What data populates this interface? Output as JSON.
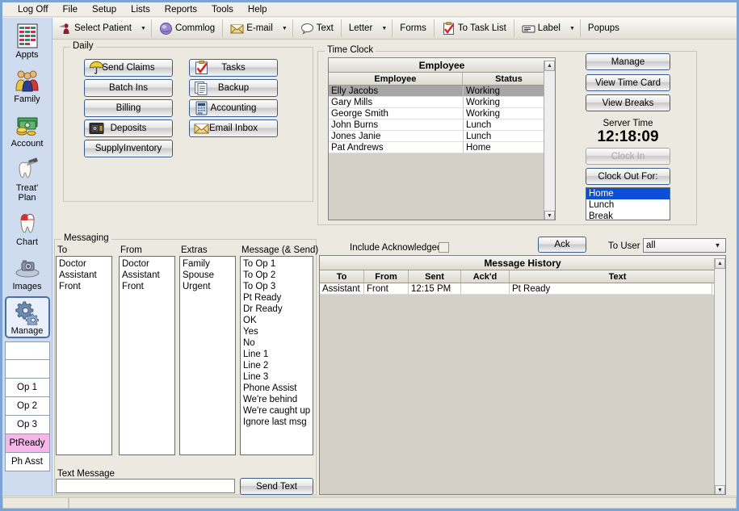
{
  "menu": {
    "items": [
      "Log Off",
      "File",
      "Setup",
      "Lists",
      "Reports",
      "Tools",
      "Help"
    ]
  },
  "toolbar": {
    "select_patient": "Select Patient",
    "commlog": "Commlog",
    "email": "E-mail",
    "text": "Text",
    "letter": "Letter",
    "forms": "Forms",
    "to_task_list": "To Task List",
    "label": "Label",
    "popups": "Popups"
  },
  "sidebar": {
    "items": [
      {
        "label": "Appts",
        "icon": "calendar-icon",
        "selected": false
      },
      {
        "label": "Family",
        "icon": "people-icon",
        "selected": false
      },
      {
        "label": "Account",
        "icon": "money-icon",
        "selected": false
      },
      {
        "label": "Treat' Plan",
        "icon": "tooth-tool-icon",
        "selected": false
      },
      {
        "label": "Chart",
        "icon": "tooth-icon",
        "selected": false
      },
      {
        "label": "Images",
        "icon": "camera-icon",
        "selected": false
      },
      {
        "label": "Manage",
        "icon": "gears-icon",
        "selected": true
      }
    ],
    "slots": [
      {
        "label": "",
        "highlight": false
      },
      {
        "label": "",
        "highlight": false
      },
      {
        "label": "Op 1",
        "highlight": false
      },
      {
        "label": "Op 2",
        "highlight": false
      },
      {
        "label": "Op 3",
        "highlight": false
      },
      {
        "label": "PtReady",
        "highlight": true
      },
      {
        "label": "Ph Asst",
        "highlight": false
      }
    ],
    "highlight_color": "#f7b6ea"
  },
  "daily": {
    "title": "Daily",
    "left_buttons": [
      {
        "label": "Send Claims",
        "icon": "umbrella-icon"
      },
      {
        "label": "Batch Ins",
        "icon": "none"
      },
      {
        "label": "Billing",
        "icon": "none"
      },
      {
        "label": "Deposits",
        "icon": "safe-icon"
      },
      {
        "label": "SupplyInventory",
        "icon": "none"
      }
    ],
    "right_buttons": [
      {
        "label": "Tasks",
        "icon": "clipboard-check-icon"
      },
      {
        "label": "Backup",
        "icon": "documents-icon"
      },
      {
        "label": "Accounting",
        "icon": "calculator-icon"
      },
      {
        "label": "Email Inbox",
        "icon": "envelope-icon"
      }
    ]
  },
  "time_clock": {
    "title": "Time Clock",
    "table_caption": "Employee",
    "columns": [
      "Employee",
      "Status"
    ],
    "rows": [
      {
        "employee": "Elly  Jacobs",
        "status": "Working",
        "selected": true
      },
      {
        "employee": "Gary  Mills",
        "status": "Working",
        "selected": false
      },
      {
        "employee": "George  Smith",
        "status": "Working",
        "selected": false
      },
      {
        "employee": "John  Burns",
        "status": "Lunch",
        "selected": false
      },
      {
        "employee": "Jones  Janie",
        "status": "Lunch",
        "selected": false
      },
      {
        "employee": "Pat  Andrews",
        "status": "Home",
        "selected": false
      }
    ],
    "manage_button": "Manage",
    "view_time_card_button": "View Time Card",
    "view_breaks_button": "View Breaks",
    "server_time_label": "Server Time",
    "server_time_value": "12:18:09",
    "clock_in_button": "Clock In",
    "clock_in_disabled": true,
    "clock_out_button": "Clock Out For:",
    "clock_out_options": [
      {
        "label": "Home",
        "selected": true
      },
      {
        "label": "Lunch",
        "selected": false
      },
      {
        "label": "Break",
        "selected": false
      }
    ]
  },
  "messaging": {
    "title": "Messaging",
    "to_label": "To",
    "from_label": "From",
    "extras_label": "Extras",
    "message_label": "Message (& Send)",
    "to_items": [
      "Doctor",
      "Assistant",
      "Front"
    ],
    "from_items": [
      "Doctor",
      "Assistant",
      "Front"
    ],
    "extras_items": [
      "Family",
      "Spouse",
      "Urgent"
    ],
    "message_items": [
      "To Op 1",
      "To Op 2",
      "To Op 3",
      "Pt Ready",
      "Dr Ready",
      "OK",
      "Yes",
      "No",
      "Line 1",
      "Line 2",
      "Line 3",
      "Phone Assist",
      "We're behind",
      "We're caught up",
      "Ignore last msg"
    ],
    "text_message_label": "Text Message",
    "text_message_value": "",
    "send_text_button": "Send Text"
  },
  "history": {
    "include_acknowledged_label": "Include Acknowledged",
    "include_acknowledged_checked": false,
    "ack_button": "Ack",
    "to_user_label": "To User",
    "to_user_value": "all",
    "table_caption": "Message History",
    "columns": [
      "To",
      "From",
      "Sent",
      "Ack'd",
      "Text"
    ],
    "rows": [
      {
        "to": "Assistant",
        "from": "Front",
        "sent": "12:15 PM",
        "ackd": "",
        "text": "Pt Ready"
      }
    ]
  }
}
